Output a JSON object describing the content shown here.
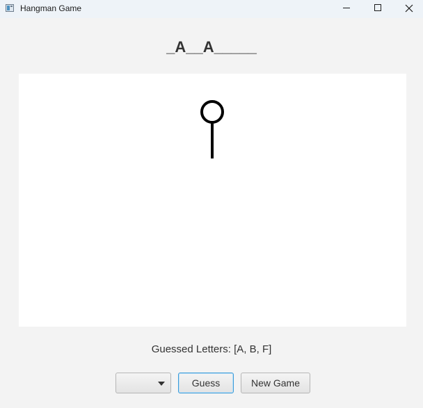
{
  "window": {
    "title": "Hangman Game",
    "controls": {
      "minimize": "minimize-icon",
      "maximize": "maximize-icon",
      "close": "close-icon"
    }
  },
  "game": {
    "masked_word": "_A__A_____",
    "guessed_label": "Guessed Letters: [A, B, F]"
  },
  "controls": {
    "letter_select_value": "",
    "guess_label": "Guess",
    "new_game_label": "New Game"
  },
  "colors": {
    "accent_focus": "#3a9bd9",
    "drawing_stroke": "#000000"
  }
}
